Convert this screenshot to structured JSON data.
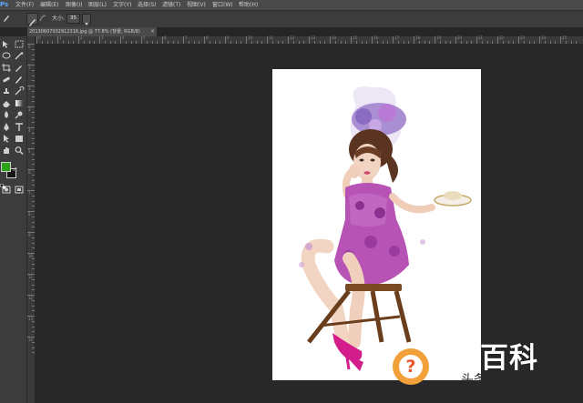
{
  "app": {
    "logo_text": "Ps"
  },
  "menubar": {
    "items": [
      "文件(F)",
      "编辑(E)",
      "图像(I)",
      "图层(L)",
      "文字(Y)",
      "选择(S)",
      "滤镜(T)",
      "视图(V)",
      "窗口(W)",
      "帮助(H)"
    ]
  },
  "options_bar": {
    "tool_icon": "brush-icon",
    "size_label": "大小:",
    "size_value": "35"
  },
  "document_tab": {
    "label": "20130607032912316.jpg @ 77.8% (背景, RGB/8)",
    "close_glyph": "×"
  },
  "ruler": {
    "h_labels": [
      "0",
      "1",
      "2",
      "3",
      "4",
      "5",
      "6",
      "7",
      "8",
      "9",
      "10",
      "11",
      "12",
      "13",
      "14",
      "15",
      "16",
      "17",
      "18",
      "19",
      "20",
      "21",
      "22",
      "23",
      "24",
      "25"
    ],
    "v_labels": [
      "0",
      "1",
      "2",
      "3",
      "4",
      "5",
      "6",
      "7",
      "8",
      "9",
      "10",
      "11",
      "12",
      "13",
      "14"
    ]
  },
  "colors": {
    "foreground": "#2ea21b",
    "background": "#161616"
  },
  "watermark": {
    "baike_text": "百科",
    "question_glyph": "?",
    "credit_text": "头条 @短腿大生"
  }
}
